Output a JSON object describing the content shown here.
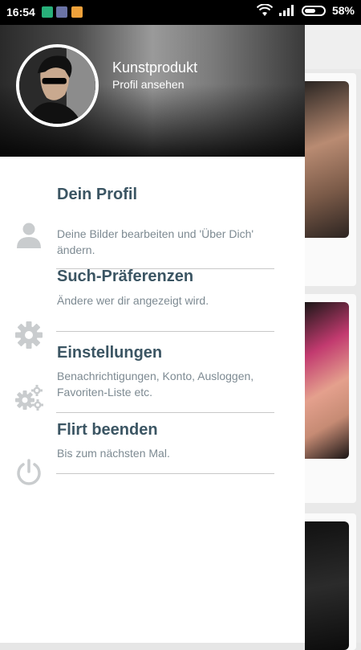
{
  "status_bar": {
    "time": "16:54",
    "battery_percent": "58%",
    "battery_level": 0.58,
    "icons": [
      "app-green-icon",
      "app-purple-icon",
      "app-orange-icon",
      "wifi-icon",
      "signal-icon",
      "battery-icon"
    ]
  },
  "drawer": {
    "profile": {
      "name": "Kunstprodukt",
      "subtitle": "Profil ansehen"
    },
    "items": [
      {
        "icon": "person-icon",
        "title": "Dein Profil",
        "description": "Deine Bilder bearbeiten und 'Über Dich' ändern."
      },
      {
        "icon": "gear-icon",
        "title": "Such-Präferenzen",
        "description": "Ändere wer dir angezeigt wird."
      },
      {
        "icon": "gears-icon",
        "title": "Einstellungen",
        "description": "Benachrichtigungen, Konto, Ausloggen, Favoriten-Liste etc."
      },
      {
        "icon": "power-icon",
        "title": "Flirt beenden",
        "description": "Bis zum nächsten Mal."
      }
    ]
  },
  "colors": {
    "title": "#3b5563",
    "description": "#7d8a92",
    "icon": "#c9ccce",
    "divider": "#c8c8c8"
  }
}
